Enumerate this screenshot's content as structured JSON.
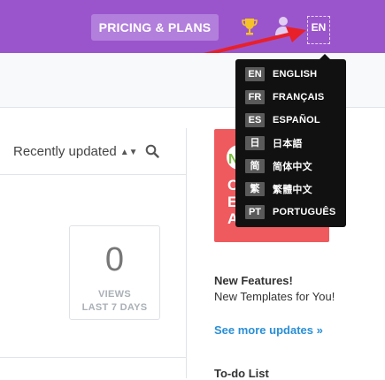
{
  "header": {
    "pricing_label": "PRICING & PLANS",
    "language_code": "EN",
    "colors": {
      "bar": "#9b55cc",
      "pricing_button": "#b27fdc",
      "arrow": "#e8202a"
    }
  },
  "toolbar": {
    "sort_label": "Recently updated",
    "sort_icon": "sort-arrows-icon",
    "search_icon": "search-icon"
  },
  "stats": {
    "views_count": "0",
    "views_label_line1": "VIEWS",
    "views_label_line2": "LAST 7 DAYS"
  },
  "promo": {
    "circle_letter": "N",
    "letters_line1": "C",
    "letters_line2": "E",
    "letters_line3": "A",
    "color": "#ef5a5e"
  },
  "news": {
    "title": "New Features!",
    "body": "New Templates for You!",
    "link": "See more updates »"
  },
  "todo": {
    "title": "To-do List"
  },
  "language_menu": {
    "items": [
      {
        "code": "EN",
        "label": "ENGLISH"
      },
      {
        "code": "FR",
        "label": "FRANÇAIS"
      },
      {
        "code": "ES",
        "label": "ESPAÑOL"
      },
      {
        "code": "日",
        "label": "日本語"
      },
      {
        "code": "简",
        "label": "简体中文"
      },
      {
        "code": "繁",
        "label": "繁體中文"
      },
      {
        "code": "PT",
        "label": "PORTUGUÊS"
      }
    ]
  }
}
